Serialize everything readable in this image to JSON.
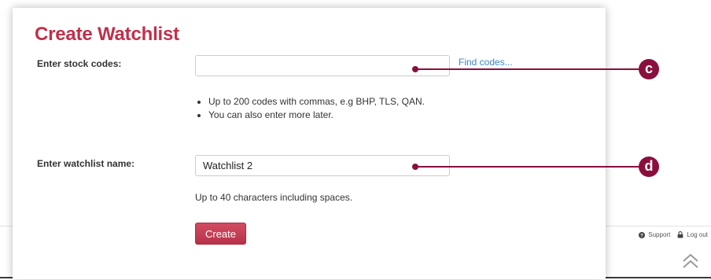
{
  "form": {
    "title": "Create Watchlist",
    "stock_codes_label": "Enter stock codes:",
    "stock_codes_value": "",
    "find_codes_link": "Find codes...",
    "stock_hints": [
      "Up to 200 codes with commas, e.g BHP, TLS, QAN.",
      "You can also enter more later."
    ],
    "name_label": "Enter watchlist name:",
    "name_value": "Watchlist 2",
    "name_hint": "Up to 40 characters including spaces.",
    "create_label": "Create"
  },
  "footer": {
    "support_label": "Support",
    "logout_label": "Log out"
  },
  "callouts": {
    "c_letter": "c",
    "d_letter": "d"
  },
  "icons": {
    "support": "question-circle-icon",
    "logout": "lock-icon",
    "scroll_top": "double-chevron-up-icon"
  },
  "colors": {
    "title": "#c0304a",
    "button": "#c23b51",
    "link": "#3a88c5",
    "callout": "#8a0f3e"
  }
}
